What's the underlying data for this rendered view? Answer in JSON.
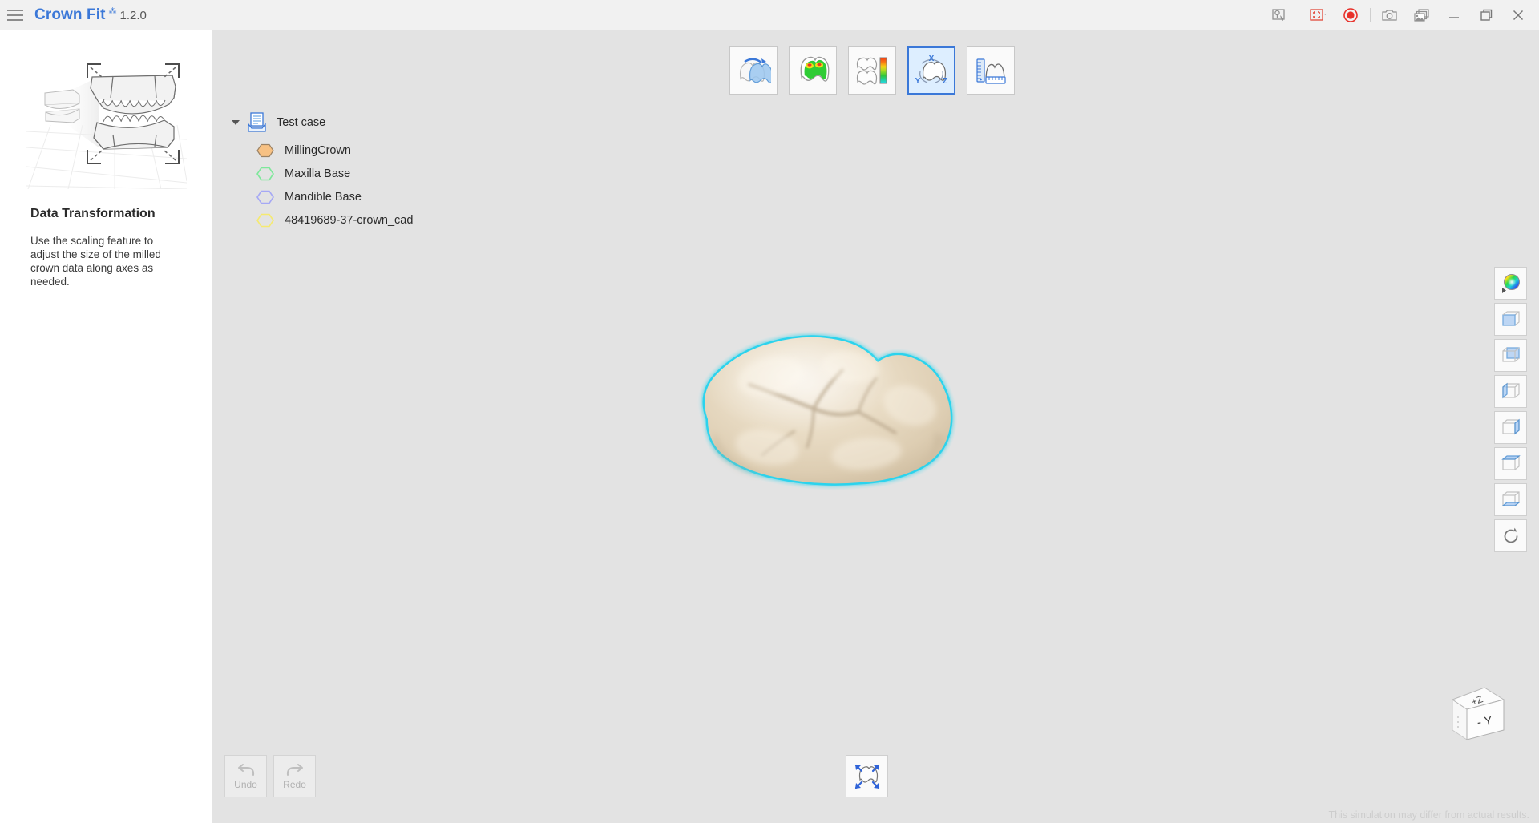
{
  "titlebar": {
    "menu_icon": "hamburger-menu-icon",
    "app_name": "Crown Fit",
    "app_mark": "⁂",
    "version": "1.2.0",
    "buttons": [
      {
        "name": "annotation-tool-icon",
        "label": ""
      },
      {
        "name": "capture-region-icon",
        "label": ""
      },
      {
        "name": "record-icon",
        "label": ""
      },
      {
        "name": "screenshot-camera-icon",
        "label": ""
      },
      {
        "name": "gallery-icon",
        "label": ""
      },
      {
        "name": "minimize-icon",
        "label": ""
      },
      {
        "name": "maximize-restore-icon",
        "label": ""
      },
      {
        "name": "close-icon",
        "label": ""
      }
    ]
  },
  "sidebar": {
    "illustration_name": "dental-arch-scaling-illustration",
    "title": "Data Transformation",
    "description": "Use the scaling feature to adjust the size of the milled crown data along axes as needed."
  },
  "modebar": {
    "items": [
      {
        "name": "mode-alignment",
        "icon": "tooth-rotate-icon",
        "active": false
      },
      {
        "name": "mode-occlusion-map",
        "icon": "tooth-heatmap-icon",
        "active": false
      },
      {
        "name": "mode-deviation-scale",
        "icon": "tooth-colorbar-icon",
        "active": false
      },
      {
        "name": "mode-transform-xyz",
        "icon": "tooth-xyz-axis-icon",
        "active": true
      },
      {
        "name": "mode-measure",
        "icon": "ruler-profile-icon",
        "active": false
      }
    ],
    "axis_labels": {
      "x": "X",
      "y": "Y",
      "z": "Z"
    }
  },
  "tree": {
    "root": {
      "label": "Test case",
      "icon": "case-document-icon",
      "expanded": true
    },
    "children": [
      {
        "label": "MillingCrown",
        "icon": "hexagon-icon",
        "color": "#f7c183",
        "filled": true
      },
      {
        "label": "Maxilla Base",
        "icon": "hexagon-icon",
        "color": "#7de89a",
        "filled": false
      },
      {
        "label": "Mandible Base",
        "icon": "hexagon-icon",
        "color": "#a5a8f5",
        "filled": false
      },
      {
        "label": "48419689-37-crown_cad",
        "icon": "hexagon-icon",
        "color": "#f5ea70",
        "filled": false
      }
    ]
  },
  "model": {
    "name": "milling-crown-3d-model",
    "highlight_color": "#22d3ee",
    "surface_color": "#e5d6bd"
  },
  "viewbar": {
    "items": [
      {
        "name": "color-picker-button",
        "icon": "color-wheel-icon"
      },
      {
        "name": "view-front-button",
        "icon": "cube-front-icon"
      },
      {
        "name": "view-back-button",
        "icon": "cube-back-icon"
      },
      {
        "name": "view-left-button",
        "icon": "cube-left-icon"
      },
      {
        "name": "view-right-button",
        "icon": "cube-right-icon"
      },
      {
        "name": "view-top-button",
        "icon": "cube-top-icon"
      },
      {
        "name": "view-bottom-button",
        "icon": "cube-bottom-icon"
      },
      {
        "name": "reset-view-button",
        "icon": "reset-rotate-icon"
      }
    ]
  },
  "gizmo": {
    "top_face": "+Z",
    "front_face": "- Y"
  },
  "bottombar": {
    "undo": {
      "label": "Undo",
      "icon": "undo-arrow-icon",
      "enabled": false
    },
    "redo": {
      "label": "Redo",
      "icon": "redo-arrow-icon",
      "enabled": false
    },
    "fit": {
      "name": "fit-to-view-button",
      "icon": "fit-tooth-icon"
    }
  },
  "footer": {
    "disclaimer": "This simulation may differ from actual results."
  }
}
